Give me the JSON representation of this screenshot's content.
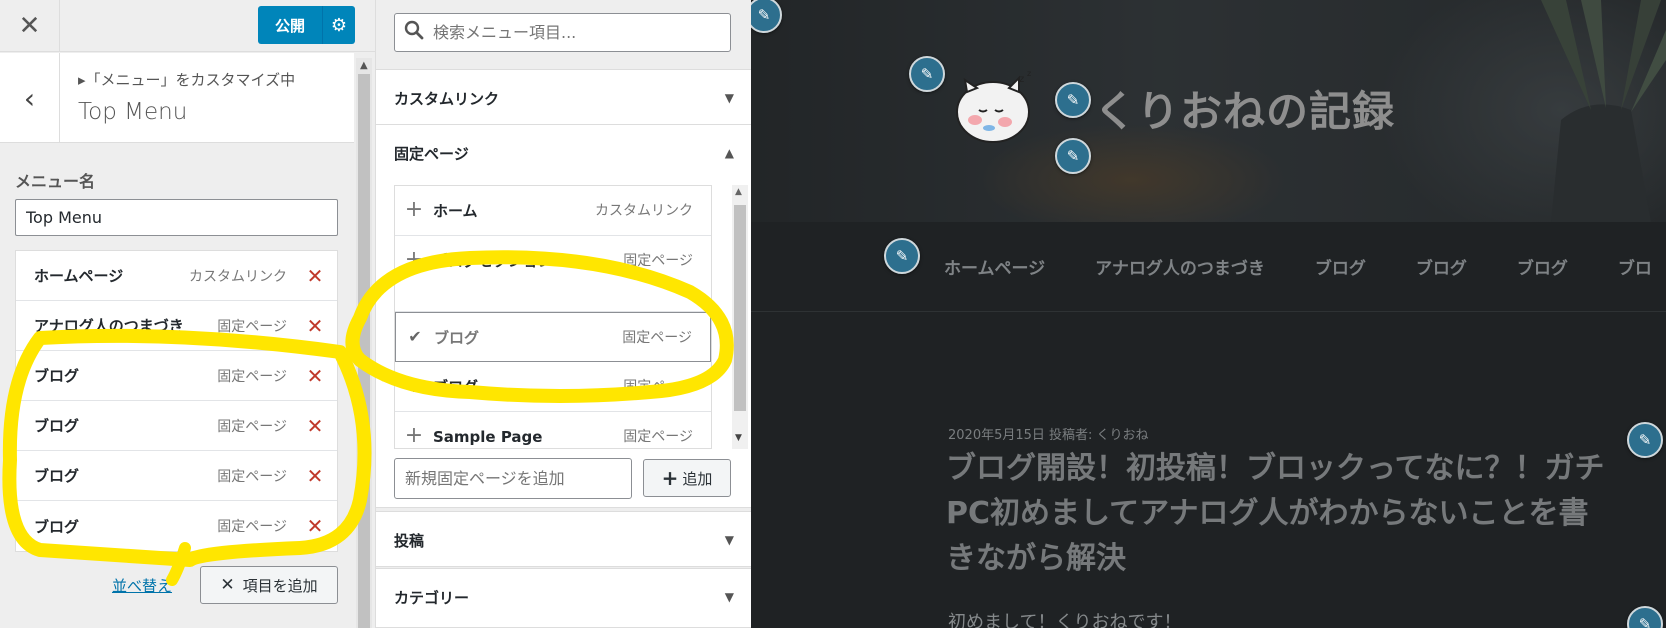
{
  "header": {
    "close_icon": "close-icon",
    "publish_label": "公開",
    "settings_icon": "gear-icon"
  },
  "section": {
    "crumb": "▸「メニュー」をカスタマイズ中",
    "title": "Top Menu"
  },
  "menu_name": {
    "label": "メニュー名",
    "value": "Top Menu"
  },
  "menu_items": [
    {
      "title": "ホームページ",
      "type": "カスタムリンク"
    },
    {
      "title": "アナログ人のつまづき",
      "type": "固定ページ"
    },
    {
      "title": "ブログ",
      "type": "固定ページ"
    },
    {
      "title": "ブログ",
      "type": "固定ページ"
    },
    {
      "title": "ブログ",
      "type": "固定ページ"
    },
    {
      "title": "ブログ",
      "type": "固定ページ"
    }
  ],
  "footer": {
    "reorder_label": "並べ替え",
    "add_items_label": "項目を追加"
  },
  "available": {
    "search_placeholder": "検索メニュー項目...",
    "sections": {
      "custom_links": "カスタムリンク",
      "pages": "固定ページ",
      "posts": "投稿",
      "categories": "カテゴリー"
    },
    "pages": [
      {
        "title": "ホーム",
        "type": "カスタムリンク",
        "added": false
      },
      {
        "title": "ブログセクション",
        "type": "固定ページ",
        "added": false
      },
      {
        "title": "ブログ",
        "type": "固定ページ",
        "added": true
      },
      {
        "title": "ブログ",
        "type": "固定ページ",
        "added": false
      },
      {
        "title": "Sample Page",
        "type": "固定ページ",
        "added": false
      }
    ],
    "new_page_placeholder": "新規固定ページを追加",
    "add_label": "追加"
  },
  "preview": {
    "site_title": "くりおねの記録",
    "nav": [
      "ホームページ",
      "アナログ人のつまづき",
      "ブログ",
      "ブログ",
      "ブログ",
      "ブロ"
    ],
    "post_meta": "2020年5月15日 投稿者: くりおね",
    "post_title": "ブログ開設！初投稿！ブロックってなに？！ガチPC初めましてアナログ人がわからないことを書きながら解決",
    "post_excerpt": "初めまして！くりおねです！"
  },
  "colors": {
    "accent": "#0085ba",
    "highlight": "#ffe600",
    "delete": "#c0392b",
    "edit_pen": "#2d6f8e"
  }
}
